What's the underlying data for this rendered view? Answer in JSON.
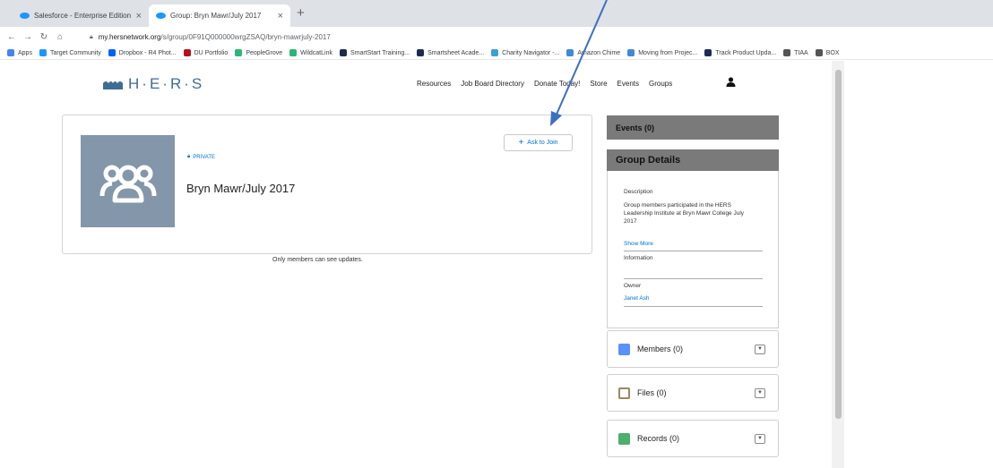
{
  "browser": {
    "tabs": [
      {
        "title": "Salesforce - Enterprise Edition",
        "active": false
      },
      {
        "title": "Group: Bryn Mawr/July 2017",
        "active": true
      }
    ],
    "new_tab_glyph": "+",
    "close_glyph": "×",
    "url_host": "my.hersnetwork.org",
    "url_path": "/s/group/0F91Q000000wrgZSAQ/bryn-mawrjuly-2017",
    "bookmarks": [
      {
        "label": "Apps",
        "color": "#4285f4"
      },
      {
        "label": "Target Community",
        "color": "#1b96ff"
      },
      {
        "label": "Dropbox - R4 Phot...",
        "color": "#0061ff"
      },
      {
        "label": "DU Portfolio",
        "color": "#b5121b"
      },
      {
        "label": "PeopleGrove",
        "color": "#2bb673"
      },
      {
        "label": "WildcatLink",
        "color": "#2bb673"
      },
      {
        "label": "SmartStart Training...",
        "color": "#1d2b4f"
      },
      {
        "label": "Smartsheet Acade...",
        "color": "#1d2b4f"
      },
      {
        "label": "Charity Navigator -...",
        "color": "#3aa0d8"
      },
      {
        "label": "Amazon Chime",
        "color": "#3f8ad6"
      },
      {
        "label": "Moving from Projec...",
        "color": "#3f8ad6"
      },
      {
        "label": "Track Product Upda...",
        "color": "#1d2b4f"
      },
      {
        "label": "TIAA",
        "color": "#555555"
      },
      {
        "label": "BOX",
        "color": "#555555"
      }
    ]
  },
  "site": {
    "logo_text": "H·E·R·S",
    "nav": [
      "Resources",
      "Job Board Directory",
      "Donate Today!",
      "Store",
      "Events",
      "Groups"
    ]
  },
  "group": {
    "privacy": "PRIVATE",
    "title": "Bryn Mawr/July 2017",
    "join_label": "Ask to Join",
    "updates_note": "Only members can see updates."
  },
  "sidebar": {
    "events_label": "Events (0)",
    "details_title": "Group Details",
    "description_label": "Description",
    "description_text": "Group members participated in the HERS Leadership Institute at Bryn Mawr College July 2017",
    "show_more": "Show More",
    "information_label": "Information",
    "owner_label": "Owner",
    "owner_name": "Janet Ash",
    "panels": [
      {
        "label": "Members (0)",
        "icon": "members-icon",
        "color": "#5b8ff9"
      },
      {
        "label": "Files (0)",
        "icon": "files-icon",
        "color": "#a08560"
      },
      {
        "label": "Records (0)",
        "icon": "records-icon",
        "color": "#4caf6e"
      }
    ]
  },
  "colors": {
    "accent": "#0070d2",
    "logo": "#3f6d93",
    "avatar_bg": "#8496aa",
    "annotation_arrow": "#3b6fc4"
  }
}
